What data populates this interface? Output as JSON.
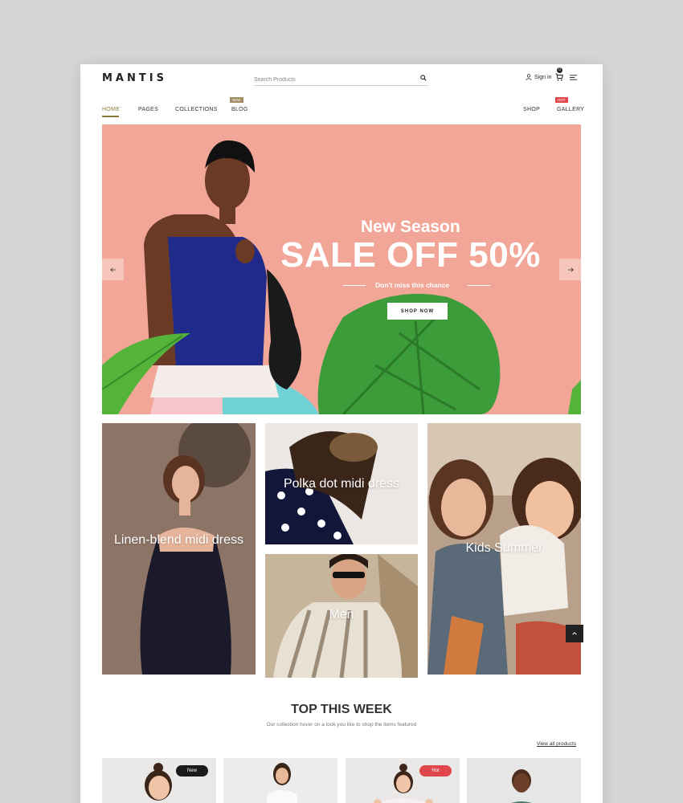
{
  "header": {
    "logo": "MANTIS",
    "search_placeholder": "Search Products",
    "signin_label": "Sign in",
    "cart_count": "0"
  },
  "nav": {
    "items": [
      "HOME",
      "PAGES",
      "COLLECTIONS",
      "BLOG",
      "SHOP",
      "GALLERY"
    ],
    "badge_new": "NEW",
    "badge_hot": "HOT"
  },
  "hero": {
    "subtitle": "New Season",
    "title": "SALE OFF 50%",
    "tagline": "Don't miss this chance",
    "button": "SHOP NOW"
  },
  "categories": [
    "Linen-blend midi dress",
    "Polka dot midi dress",
    "Men",
    "Kids Summer"
  ],
  "top_week": {
    "title": "TOP THIS WEEK",
    "subtitle": "Our collection hover on a look you like to shop the items featured",
    "view_all": "View all products",
    "badges": [
      "New",
      "Hot"
    ]
  },
  "colors": {
    "hero_bg": "#f2a698",
    "accent": "#8a7a3a",
    "badge_new": "#a28b60",
    "badge_hot": "#e0474c"
  }
}
